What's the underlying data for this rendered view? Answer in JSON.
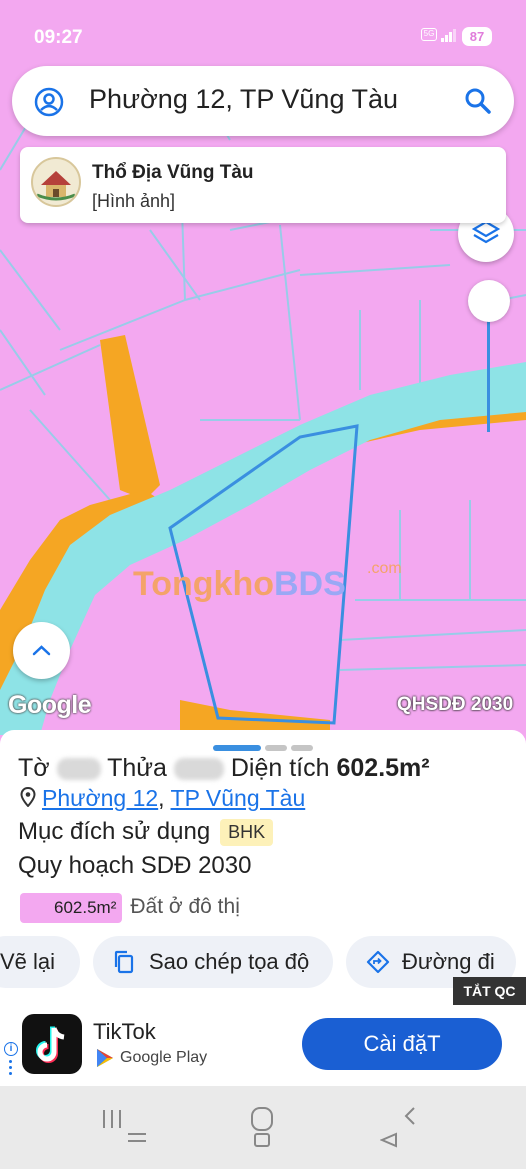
{
  "status_bar": {
    "time": "09:27",
    "network": "5G",
    "battery": "87"
  },
  "search": {
    "query": "Phường 12, TP Vũng Tàu",
    "account_icon": "account-circle-icon",
    "search_icon": "search-icon"
  },
  "popup": {
    "title": "Thổ Địa Vũng Tàu",
    "subtitle": "[Hình ảnh]"
  },
  "map": {
    "google_logo": "Google",
    "layer_label": "QHSDĐ 2030",
    "watermark_main": "Tongkho",
    "watermark_accent": "BDS",
    "watermark_suffix": ".com",
    "colors": {
      "land": "#f3a8f0",
      "road": "#f5a623",
      "water": "#8ee3e6",
      "parcel": "#3a8fe0"
    }
  },
  "parcel": {
    "line1_a": "Tờ",
    "line1_b": "Thửa",
    "line1_c": "Diện tích",
    "area": "602.5m²",
    "ward": "Phường 12",
    "city": "TP Vũng Tàu",
    "purpose_label": "Mục đích sử dụng",
    "purpose_code": "BHK",
    "plan_label": "Quy hoạch SDĐ 2030",
    "zone_area": "602.5m²",
    "zone_type": "Đất ở đô thị"
  },
  "actions": {
    "redraw": "Vẽ lại",
    "copy_coords": "Sao chép tọa độ",
    "directions": "Đường đi"
  },
  "ad": {
    "close_label": "TẮT QC",
    "app_name": "TikTok",
    "store": "Google Play",
    "install_label": "Cài đặT"
  }
}
